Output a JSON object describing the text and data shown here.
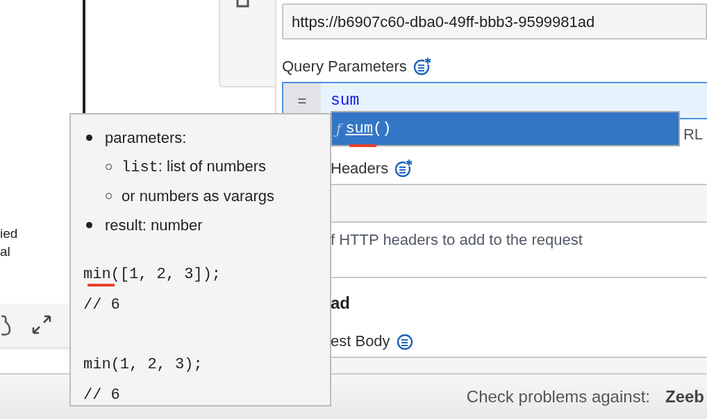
{
  "canvas": {
    "label_lines": [
      "ied",
      "al"
    ]
  },
  "properties": {
    "url": {
      "value": "https://b6907c60-dba0-49ff-bbb3-9599981ad"
    },
    "query_parameters": {
      "label": "Query Parameters",
      "prefix": "=",
      "value": "sum",
      "description": "RL"
    },
    "headers": {
      "label": "Headers",
      "description": "f HTTP headers to add to the request"
    },
    "payload": {
      "title": "ad",
      "request_body_label": "est Body"
    }
  },
  "autocomplete": {
    "items": [
      {
        "icon": "ƒ",
        "name": "sum",
        "args": "()",
        "selected": true,
        "underlined": true
      }
    ]
  },
  "tooltip": {
    "bullets": [
      {
        "text": "parameters:",
        "children": [
          {
            "code": "list",
            "text": ": list of numbers"
          },
          {
            "text": "or numbers as varargs"
          }
        ]
      },
      {
        "text": "result: number"
      }
    ],
    "examples": [
      {
        "code": "min([1, 2, 3]);",
        "result": "// 6",
        "underlined": true
      },
      {
        "code": "min(1, 2, 3);",
        "result": "// 6",
        "underlined": false
      }
    ]
  },
  "status_bar": {
    "label": "Check problems against:",
    "engine": "Zeeb"
  }
}
